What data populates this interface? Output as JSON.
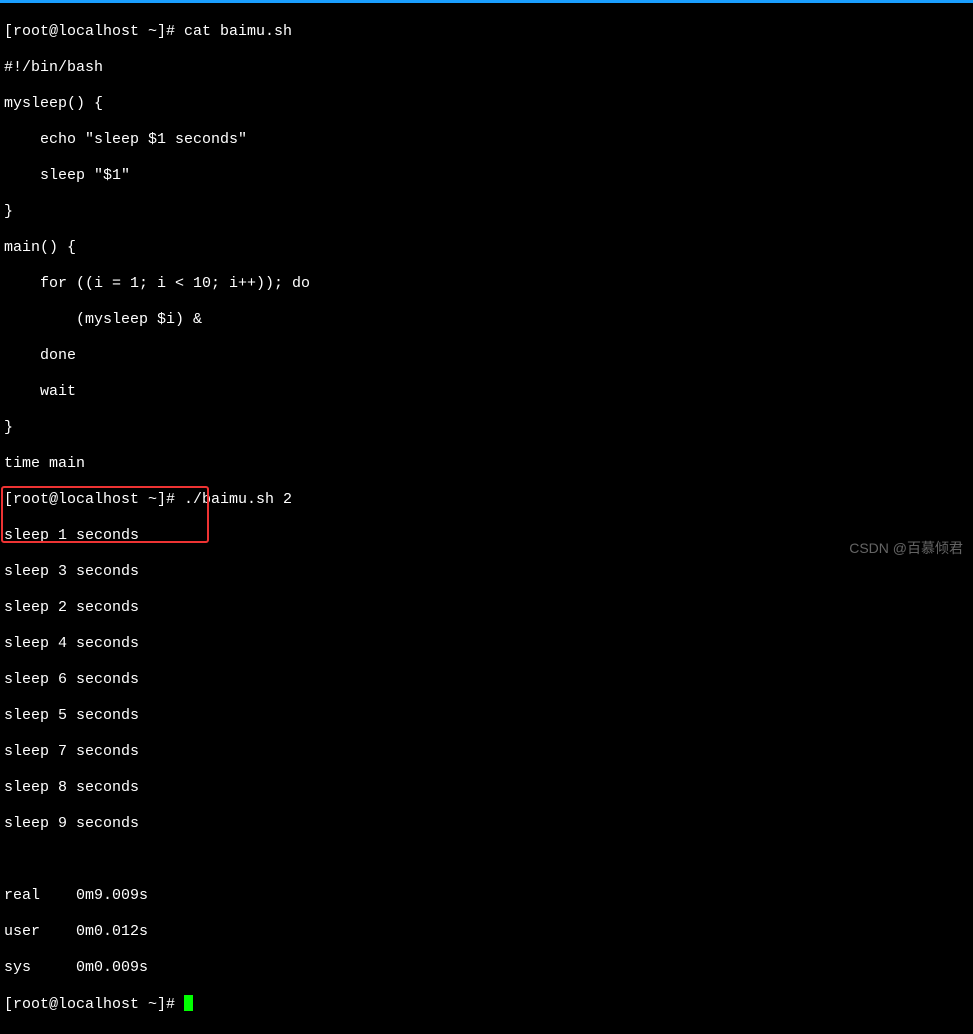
{
  "prompt1": "[root@localhost ~]# cat baimu.sh",
  "script": {
    "l1": "#!/bin/bash",
    "l2": "mysleep() {",
    "l3": "    echo \"sleep $1 seconds\"",
    "l4": "    sleep \"$1\"",
    "l5": "}",
    "l6": "main() {",
    "l7": "    for ((i = 1; i < 10; i++)); do",
    "l8": "        (mysleep $i) &",
    "l9": "    done",
    "l10": "    wait",
    "l11": "}",
    "l12": "time main"
  },
  "prompt2": "[root@localhost ~]# ./baimu.sh 2",
  "output": {
    "o1": "sleep 1 seconds",
    "o2": "sleep 3 seconds",
    "o3": "sleep 2 seconds",
    "o4": "sleep 4 seconds",
    "o5": "sleep 6 seconds",
    "o6": "sleep 5 seconds",
    "o7": "sleep 7 seconds",
    "o8": "sleep 8 seconds",
    "o9": "sleep 9 seconds"
  },
  "blank": " ",
  "time": {
    "real": "real    0m9.009s",
    "user": "user    0m0.012s",
    "sys": "sys     0m0.009s"
  },
  "prompt3": "[root@localhost ~]# ",
  "watermark": "CSDN @百慕倾君"
}
